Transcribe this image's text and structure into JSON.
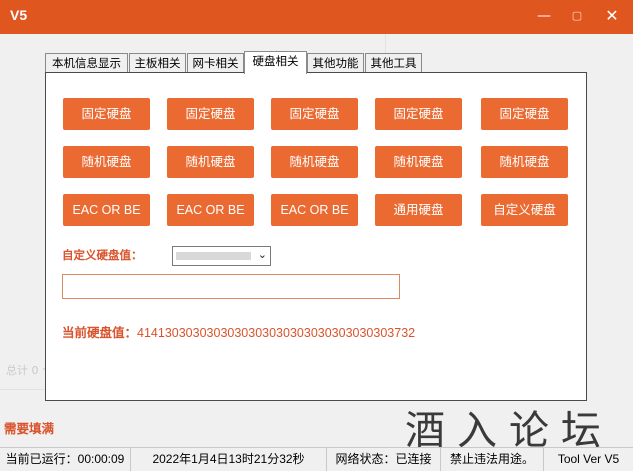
{
  "window": {
    "title": "V5",
    "minimize_glyph": "—",
    "maximize_glyph": "▢",
    "close_glyph": "✕"
  },
  "background": {
    "ghost_text": "总计 0 个 0 字节(1 个文件)"
  },
  "tabs": [
    {
      "label": "本机信息显示",
      "active": false
    },
    {
      "label": "主板相关",
      "active": false
    },
    {
      "label": "网卡相关",
      "active": false
    },
    {
      "label": "硬盘相关",
      "active": true
    },
    {
      "label": "其他功能",
      "active": false
    },
    {
      "label": "其他工具",
      "active": false
    }
  ],
  "buttons": {
    "row1": [
      "固定硬盘",
      "固定硬盘",
      "固定硬盘",
      "固定硬盘",
      "固定硬盘"
    ],
    "row2": [
      "随机硬盘",
      "随机硬盘",
      "随机硬盘",
      "随机硬盘",
      "随机硬盘"
    ],
    "row3": [
      "EAC OR BE",
      "EAC OR BE",
      "EAC OR BE",
      "通用硬盘",
      "自定义硬盘"
    ]
  },
  "custom": {
    "label": "自定义硬盘值：",
    "select_value": "",
    "input_value": ""
  },
  "current": {
    "label": "当前硬盘值：",
    "value": "4141303030303030303030303030303030303732"
  },
  "need_fill": "需要填满",
  "watermark": "酒入论坛",
  "status": {
    "runtime": "当前已运行：00:00:09",
    "datetime": "2022年1月4日13时21分32秒",
    "network": "网络状态：已连接",
    "notice": "禁止违法用途。",
    "version": "Tool Ver V5"
  },
  "colors": {
    "accent": "#e0561f",
    "button": "#ea6a32",
    "label": "#d9532c"
  }
}
